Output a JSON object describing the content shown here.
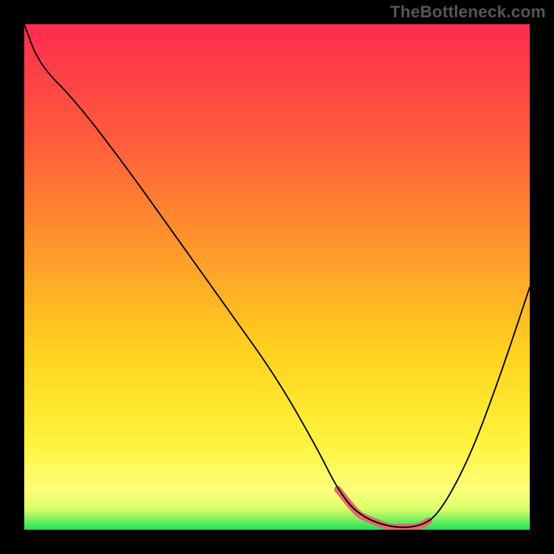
{
  "watermark": "TheBottleneck.com",
  "colors": {
    "gradient_top": "#ff2b4f",
    "gradient_mid": "#ffd900",
    "gradient_low": "#ffff6a",
    "gradient_bottom": "#1fe05a",
    "curve": "#000000",
    "accent": "#e26a6a",
    "frame": "#000000"
  },
  "chart_data": {
    "type": "line",
    "title": "",
    "xlabel": "",
    "ylabel": "",
    "xlim": [
      0,
      100
    ],
    "ylim": [
      0,
      100
    ],
    "legend": false,
    "grid": false,
    "x": [
      0,
      3,
      10,
      20,
      30,
      40,
      50,
      58,
      62,
      66,
      72,
      78,
      82,
      88,
      94,
      100
    ],
    "values": [
      100,
      92,
      85,
      72,
      58,
      44,
      30,
      16,
      8,
      3,
      0.5,
      0.5,
      3,
      14,
      30,
      48
    ],
    "accent_region_x": [
      62,
      80
    ],
    "annotations": []
  }
}
